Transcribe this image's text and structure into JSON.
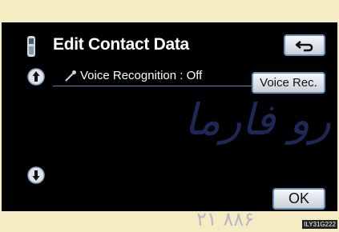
{
  "header": {
    "title": "Edit Contact Data",
    "phone_icon": "phone-handset-icon",
    "back_icon": "return-arrow-icon"
  },
  "list": {
    "rows": [
      {
        "icon": "microphone-icon",
        "label": "Voice Recognition : Off"
      }
    ],
    "scroll_up_icon": "scroll-up-arrow-icon",
    "scroll_down_icon": "scroll-down-arrow-icon"
  },
  "buttons": {
    "voice_rec_label": "Voice Rec.",
    "ok_label": "OK"
  },
  "watermark": {
    "text": "رو فارما",
    "numbers": "۲۱ ۸۸۶"
  },
  "figure_code": "ILY31G222",
  "colors": {
    "screen_bg": "#000000",
    "button_border": "#6c8fb2",
    "separator": "#4a8ac0",
    "page_bg": "#f6ecc4"
  }
}
